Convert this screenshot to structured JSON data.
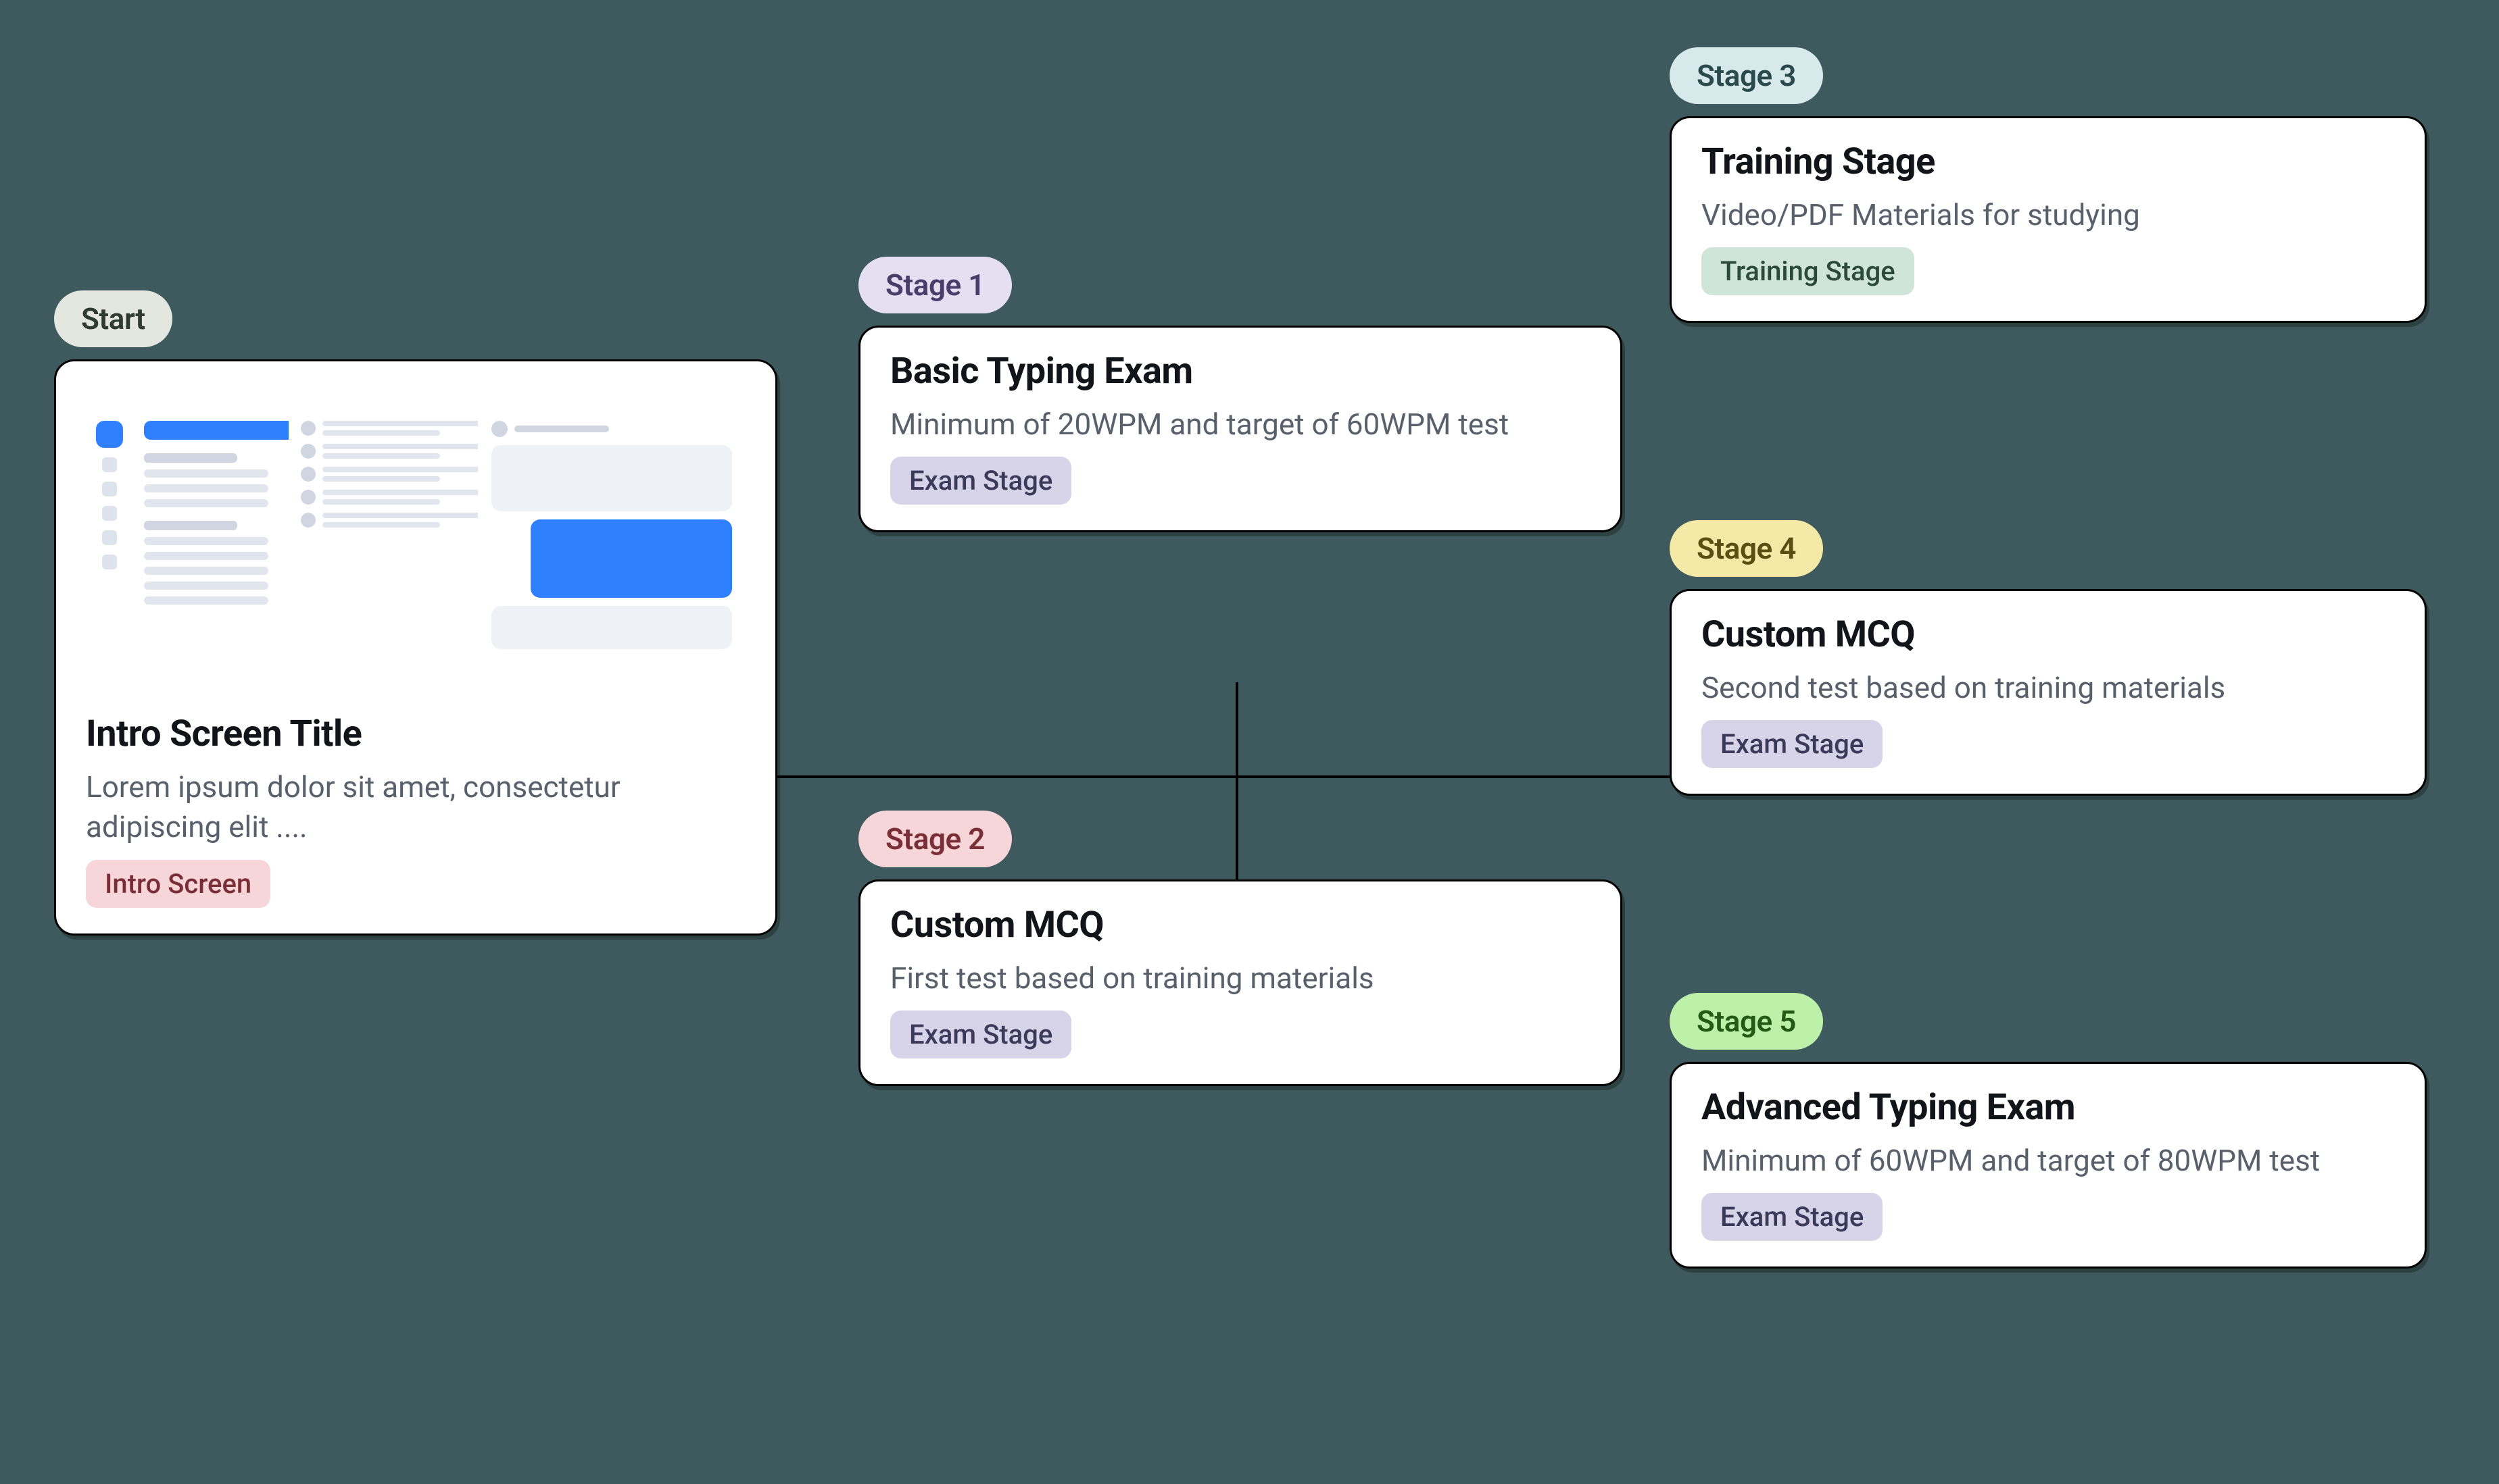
{
  "nodes": {
    "start": {
      "pill": "Start",
      "title": "Intro Screen Title",
      "subtitle": "Lorem ipsum dolor sit amet, consectetur adipiscing elit ....",
      "tag": "Intro Screen"
    },
    "stage1": {
      "pill": "Stage 1",
      "title": "Basic Typing Exam",
      "subtitle": "Minimum of 20WPM and target of 60WPM test",
      "tag": "Exam Stage"
    },
    "stage2": {
      "pill": "Stage 2",
      "title": "Custom MCQ",
      "subtitle": "First test based on training materials",
      "tag": "Exam Stage"
    },
    "stage3": {
      "pill": "Stage 3",
      "title": "Training Stage",
      "subtitle": "Video/PDF Materials for studying",
      "tag": "Training Stage"
    },
    "stage4": {
      "pill": "Stage 4",
      "title": "Custom MCQ",
      "subtitle": "Second test based on training materials",
      "tag": "Exam Stage"
    },
    "stage5": {
      "pill": "Stage 5",
      "title": "Advanced Typing Exam",
      "subtitle": "Minimum of 60WPM and target of 80WPM test",
      "tag": "Exam Stage"
    }
  },
  "colors": {
    "background": "#3f5a5e",
    "pills": {
      "start": {
        "bg": "#e3e7df",
        "fg": "#2f3a30"
      },
      "stage1": {
        "bg": "#e6dff2",
        "fg": "#4a3c6b"
      },
      "stage2": {
        "bg": "#f6d6d9",
        "fg": "#7a2f38"
      },
      "stage3": {
        "bg": "#d7e9ea",
        "fg": "#2b4a4d"
      },
      "stage4": {
        "bg": "#f4e9a6",
        "fg": "#5a4e12"
      },
      "stage5": {
        "bg": "#bdf0a8",
        "fg": "#245a18"
      }
    },
    "tags": {
      "intro": {
        "bg": "#f6d6d9",
        "fg": "#7a2f38"
      },
      "exam": {
        "bg": "#d7d3e8",
        "fg": "#3b3a5a"
      },
      "training": {
        "bg": "#cfe5d7",
        "fg": "#2b4a3a"
      }
    }
  },
  "edges": [
    [
      "start",
      "midVLeft"
    ],
    [
      "midVLeft",
      "stage1"
    ],
    [
      "midVLeft",
      "stage2"
    ],
    [
      "midH",
      "stage3"
    ],
    [
      "midH",
      "stage4"
    ],
    [
      "midH",
      "stage5"
    ]
  ]
}
